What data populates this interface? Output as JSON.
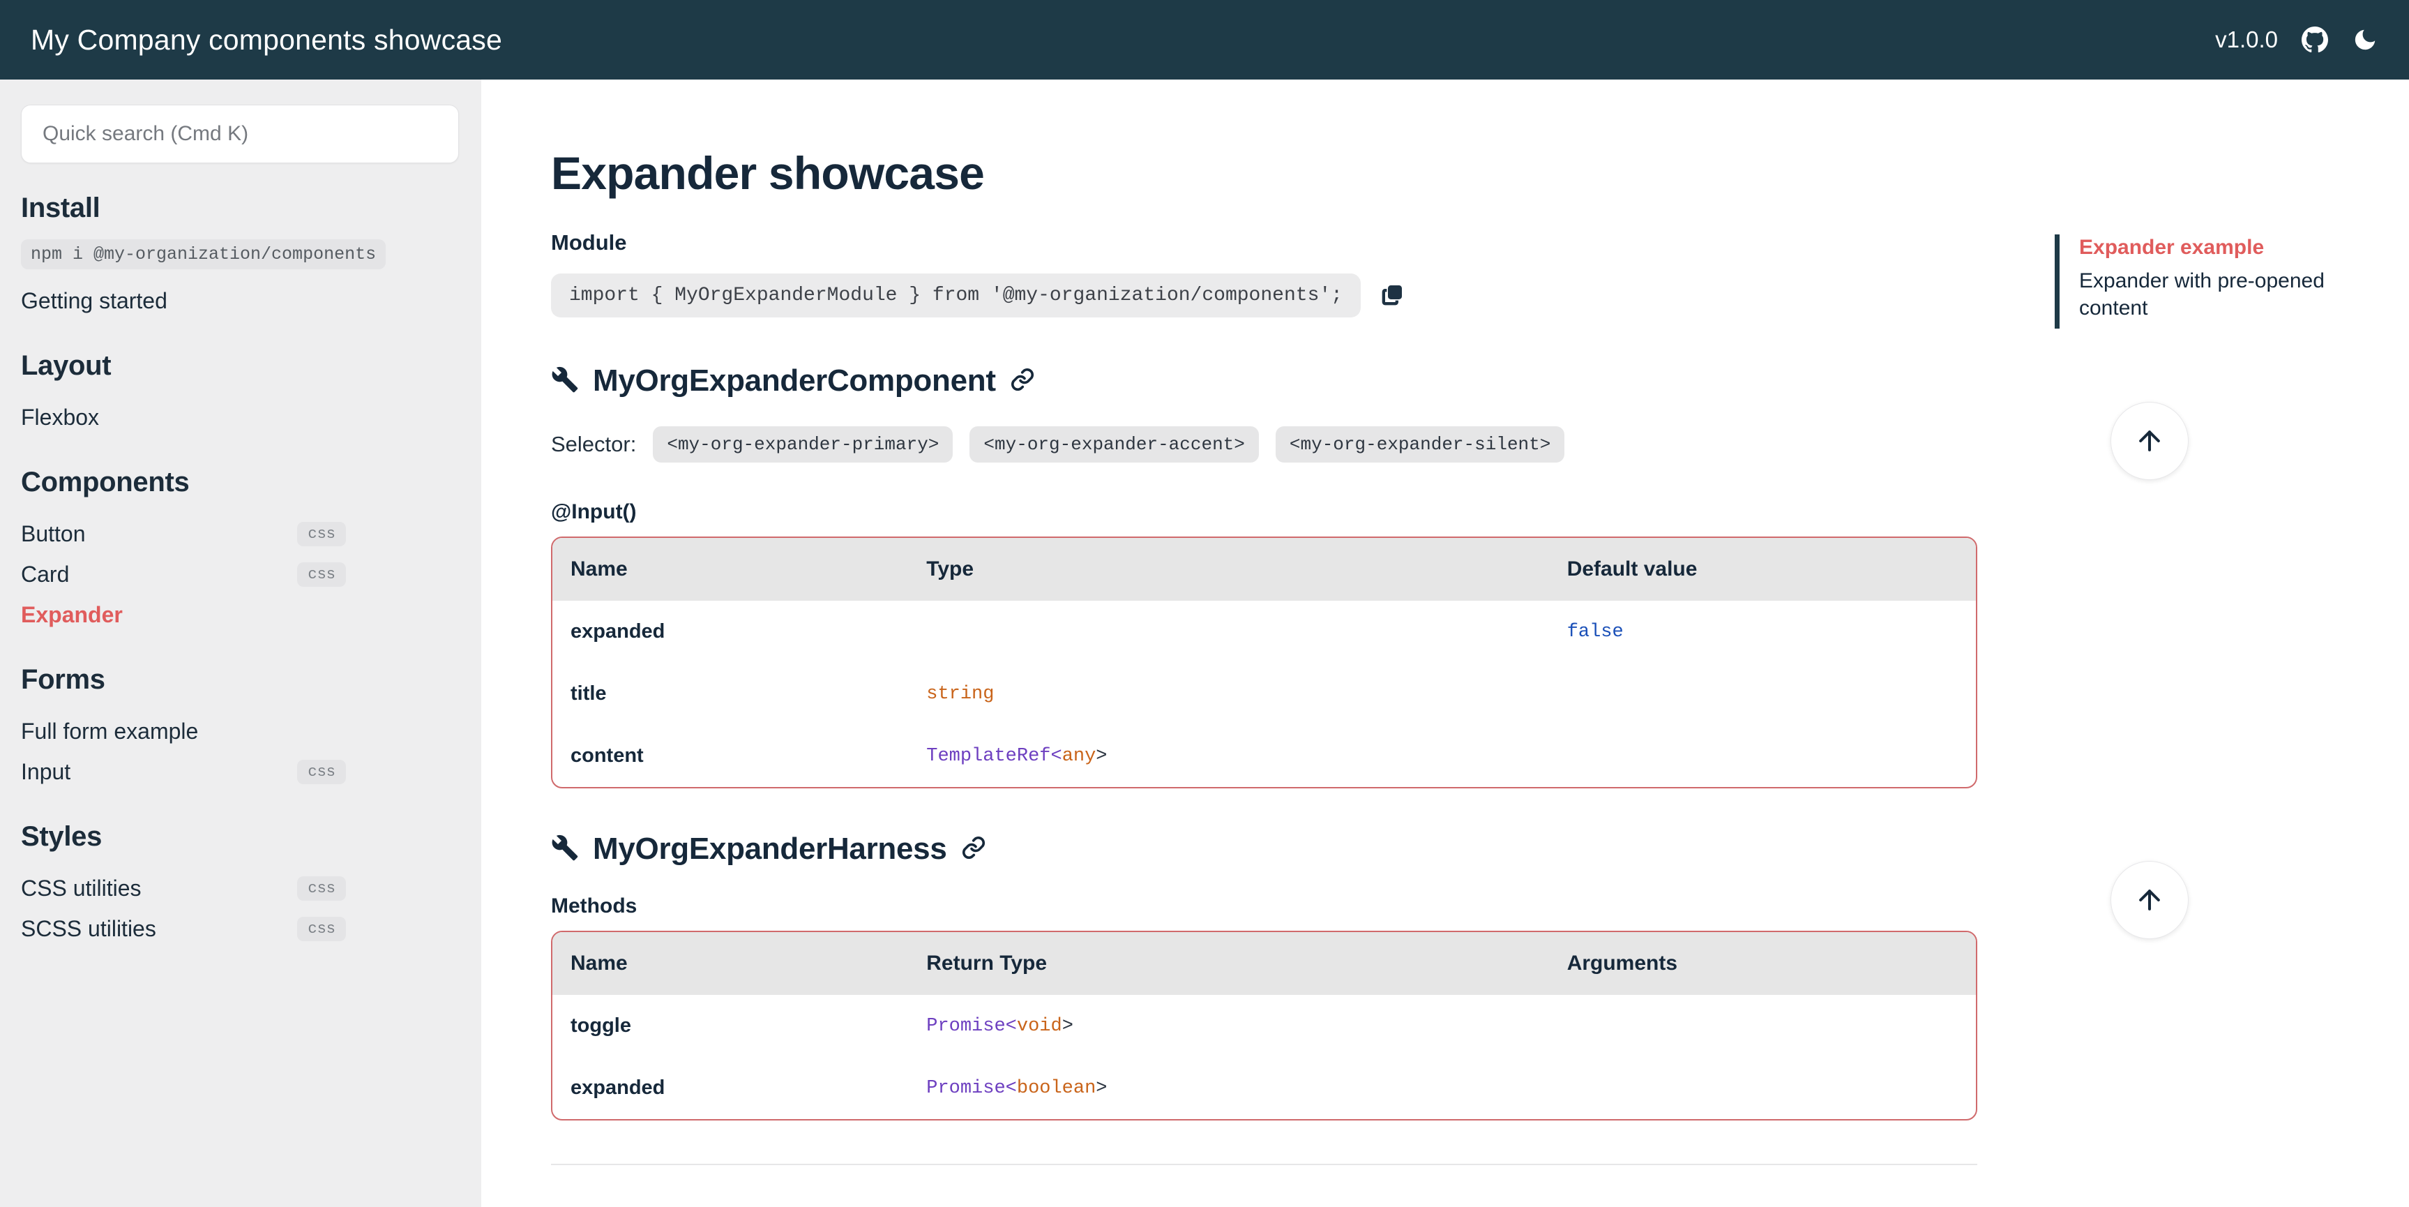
{
  "header": {
    "title": "My Company components showcase",
    "version": "v1.0.0",
    "github_icon": "github-icon",
    "theme_icon": "moon-icon"
  },
  "sidebar": {
    "search": {
      "placeholder": "Quick search (Cmd K)",
      "value": ""
    },
    "sections": [
      {
        "heading": "Install",
        "npm_command": "npm i @my-organization/components",
        "items": [
          {
            "label": "Getting started",
            "badge": "",
            "active": false
          }
        ]
      },
      {
        "heading": "Layout",
        "items": [
          {
            "label": "Flexbox",
            "badge": "",
            "active": false
          }
        ]
      },
      {
        "heading": "Components",
        "items": [
          {
            "label": "Button",
            "badge": "css",
            "active": false
          },
          {
            "label": "Card",
            "badge": "css",
            "active": false
          },
          {
            "label": "Expander",
            "badge": "",
            "active": true
          }
        ]
      },
      {
        "heading": "Forms",
        "items": [
          {
            "label": "Full form example",
            "badge": "",
            "active": false
          },
          {
            "label": "Input",
            "badge": "css",
            "active": false
          }
        ]
      },
      {
        "heading": "Styles",
        "items": [
          {
            "label": "CSS utilities",
            "badge": "css",
            "active": false
          },
          {
            "label": "SCSS utilities",
            "badge": "css",
            "active": false
          }
        ]
      }
    ]
  },
  "main": {
    "page_title": "Expander showcase",
    "module": {
      "label": "Module",
      "import_statement": "import { MyOrgExpanderModule } from '@my-organization/components';",
      "copy_icon": "copy-icon"
    },
    "component_section": {
      "wrench_icon": "wrench-icon",
      "title": "MyOrgExpanderComponent",
      "anchor_icon": "link-icon",
      "selector_label": "Selector:",
      "selectors": [
        "<my-org-expander-primary>",
        "<my-org-expander-accent>",
        "<my-org-expander-silent>"
      ],
      "table_label": "@Input()",
      "columns": [
        "Name",
        "Type",
        "Default value"
      ],
      "rows": [
        {
          "name": "expanded",
          "type_prefix": "",
          "type_generic": "",
          "type_suffix": "",
          "default": "false"
        },
        {
          "name": "title",
          "type_prefix": "string",
          "type_generic": "",
          "type_suffix": "",
          "default": ""
        },
        {
          "name": "content",
          "type_prefix": "TemplateRef<",
          "type_generic": "any",
          "type_suffix": ">",
          "default": ""
        }
      ],
      "scroll_top_icon": "arrow-up-icon"
    },
    "harness_section": {
      "wrench_icon": "wrench-icon",
      "title": "MyOrgExpanderHarness",
      "anchor_icon": "link-icon",
      "table_label": "Methods",
      "columns": [
        "Name",
        "Return Type",
        "Arguments"
      ],
      "rows": [
        {
          "name": "toggle",
          "type_prefix": "Promise<",
          "type_generic": "void",
          "type_suffix": ">",
          "arguments": ""
        },
        {
          "name": "expanded",
          "type_prefix": "Promise<",
          "type_generic": "boolean",
          "type_suffix": ">",
          "arguments": ""
        }
      ],
      "scroll_top_icon": "arrow-up-icon"
    }
  },
  "toc": {
    "items": [
      {
        "label": "Expander example",
        "active": true
      },
      {
        "label": "Expander with pre-opened content",
        "active": false
      }
    ]
  },
  "colors": {
    "header_bg": "#1e3a47",
    "sidebar_bg": "#eeeeef",
    "accent_red": "#e05c5c",
    "table_border": "#d06a6c",
    "table_header_bg": "#e6e6e6",
    "text_dark": "#16283a"
  }
}
